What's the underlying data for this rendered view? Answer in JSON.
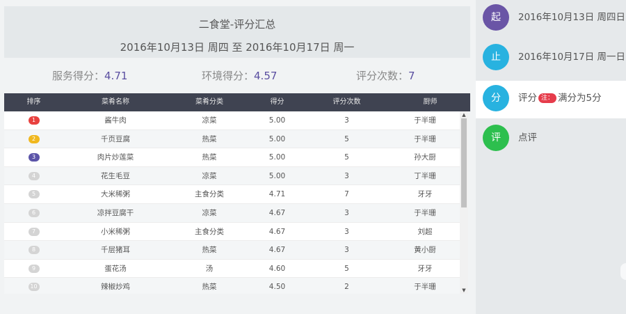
{
  "header": {
    "title": "二食堂-评分汇总",
    "range": "2016年10月13日 周四 至 2016年10月17日 周一"
  },
  "stats": {
    "service_label": "服务得分：",
    "service_value": "4.71",
    "env_label": "环境得分：",
    "env_value": "4.57",
    "count_label": "评分次数：",
    "count_value": "7"
  },
  "table": {
    "columns": [
      "排序",
      "菜肴名称",
      "菜肴分类",
      "得分",
      "评分次数",
      "厨师"
    ],
    "rows": [
      {
        "rank": "1",
        "name": "酱牛肉",
        "category": "凉菜",
        "score": "5.00",
        "count": "3",
        "chef": "于半珊"
      },
      {
        "rank": "2",
        "name": "千页豆腐",
        "category": "热菜",
        "score": "5.00",
        "count": "5",
        "chef": "于半珊"
      },
      {
        "rank": "3",
        "name": "肉片炒莲菜",
        "category": "热菜",
        "score": "5.00",
        "count": "5",
        "chef": "孙大厨"
      },
      {
        "rank": "4",
        "name": "花生毛豆",
        "category": "凉菜",
        "score": "5.00",
        "count": "3",
        "chef": "丁半珊"
      },
      {
        "rank": "5",
        "name": "大米稀粥",
        "category": "主食分类",
        "score": "4.71",
        "count": "7",
        "chef": "牙牙"
      },
      {
        "rank": "6",
        "name": "凉拌豆腐干",
        "category": "凉菜",
        "score": "4.67",
        "count": "3",
        "chef": "于半珊"
      },
      {
        "rank": "7",
        "name": "小米稀粥",
        "category": "主食分类",
        "score": "4.67",
        "count": "3",
        "chef": "刘超"
      },
      {
        "rank": "8",
        "name": "千层猪耳",
        "category": "热菜",
        "score": "4.67",
        "count": "3",
        "chef": "黄小厨"
      },
      {
        "rank": "9",
        "name": "蛋花汤",
        "category": "汤",
        "score": "4.60",
        "count": "5",
        "chef": "牙牙"
      },
      {
        "rank": "10",
        "name": "辣椒炒鸡",
        "category": "热菜",
        "score": "4.50",
        "count": "2",
        "chef": "于半珊"
      }
    ]
  },
  "sidebar": {
    "start": {
      "badge": "起",
      "text": "2016年10月13日 周四日",
      "color": "#6a55a6"
    },
    "end": {
      "badge": "止",
      "text": "2016年10月17日 周一日",
      "color": "#28b2e0"
    },
    "score": {
      "badge": "分",
      "text_before": "评分",
      "note": "注：",
      "text_after": "满分为5分",
      "color": "#28b2e0"
    },
    "comment": {
      "badge": "评",
      "text": "点评",
      "color": "#2dbf4e"
    }
  },
  "colors": {
    "table_header_bg": "#3f4351",
    "stat_value": "#5a4ea0",
    "rank1": "#e8413f",
    "rank2": "#f0b81f",
    "rank3": "#5b54a8",
    "note_badge": "#e63c4b"
  },
  "scrollbar": {
    "up_icon": "triangle-up-icon",
    "down_icon": "triangle-down-icon"
  }
}
